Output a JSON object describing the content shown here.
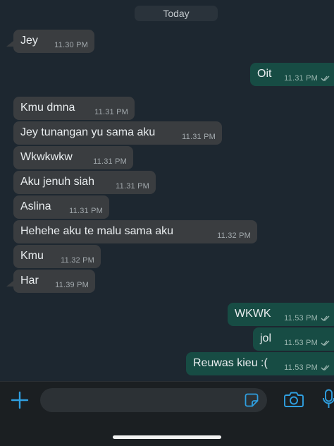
{
  "chat": {
    "date_label": "Today",
    "messages": [
      {
        "direction": "in",
        "text": "Jey",
        "time": "11.30 PM"
      },
      {
        "direction": "out",
        "text": "Oit",
        "time": "11.31 PM",
        "ticks": "read"
      },
      {
        "direction": "in",
        "text": "Kmu dmna",
        "time": "11.31 PM"
      },
      {
        "direction": "in",
        "text": "Jey tunangan yu sama aku",
        "time": "11.31 PM"
      },
      {
        "direction": "in",
        "text": "Wkwkwkw",
        "time": "11.31 PM"
      },
      {
        "direction": "in",
        "text": "Aku jenuh siah",
        "time": "11.31 PM"
      },
      {
        "direction": "in",
        "text": "Aslina",
        "time": "11.31 PM"
      },
      {
        "direction": "in",
        "text": "Hehehe aku te malu sama aku",
        "time": "11.32 PM"
      },
      {
        "direction": "in",
        "text": "Kmu",
        "time": "11.32 PM"
      },
      {
        "direction": "in",
        "text": "Har",
        "time": "11.39 PM"
      },
      {
        "direction": "out",
        "text": "WKWK",
        "time": "11.53 PM",
        "ticks": "read"
      },
      {
        "direction": "out",
        "text": "jol",
        "time": "11.53 PM",
        "ticks": "read"
      },
      {
        "direction": "out",
        "text": "Reuwas kieu :(",
        "time": "11.53 PM",
        "ticks": "read"
      }
    ]
  },
  "composer": {
    "input_value": "",
    "icons": [
      "plus-icon",
      "sticker-icon",
      "camera-icon",
      "microphone-icon"
    ]
  },
  "colors": {
    "background": "#1d2730",
    "incoming_bubble": "#3a3d40",
    "outgoing_bubble": "#174c44",
    "accent": "#2f9fe0"
  }
}
